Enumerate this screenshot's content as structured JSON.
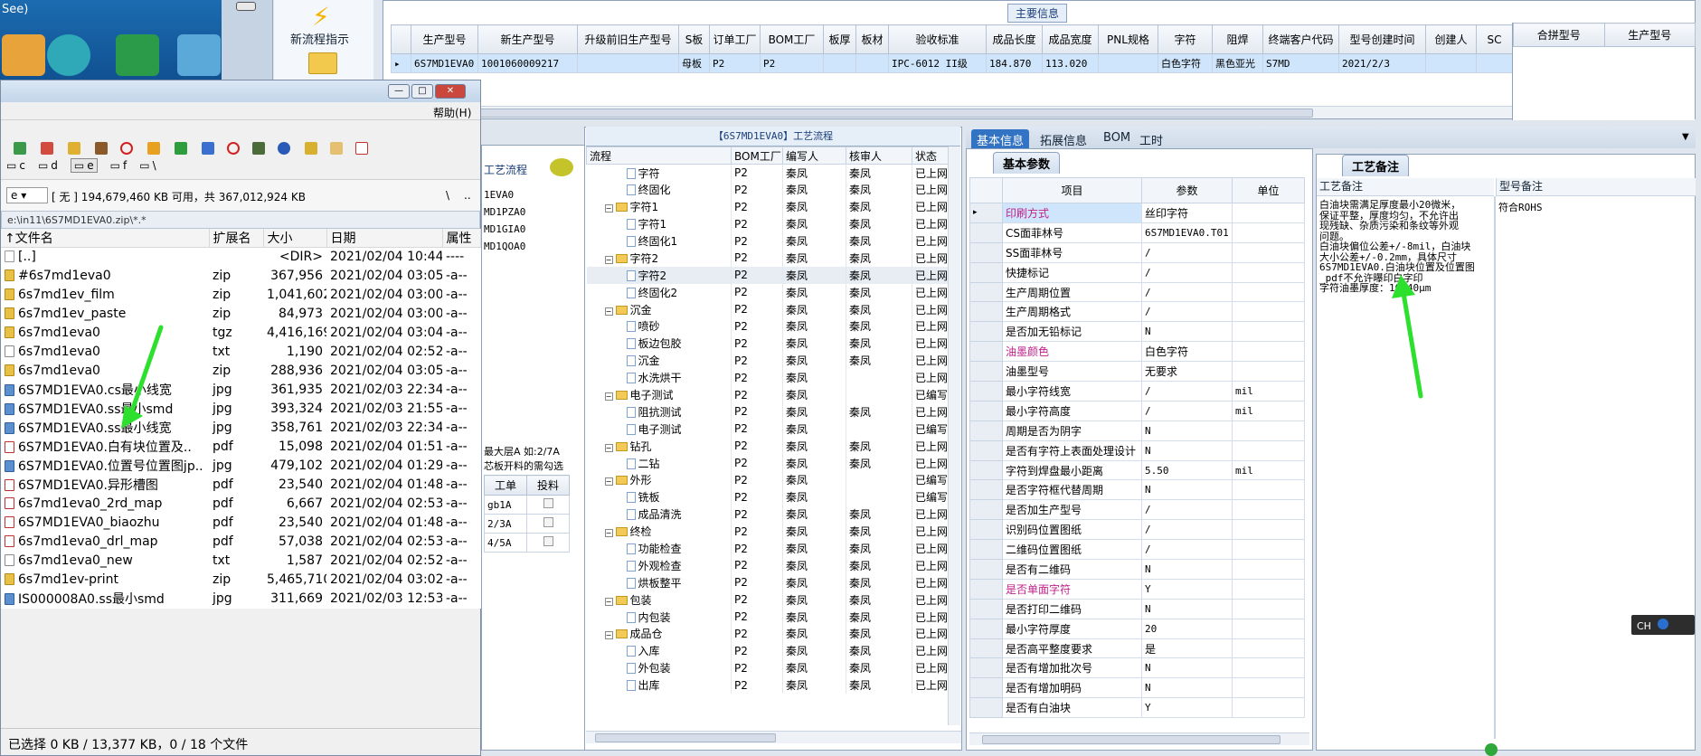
{
  "desktop": {
    "partial_text": "See)"
  },
  "toolbar": {
    "new_flow_label": "新流程指示"
  },
  "main_info": {
    "title": "主要信息",
    "columns": [
      "生产型号",
      "新生产型号",
      "升级前旧生产型号",
      "S板",
      "订单工厂",
      "BOM工厂",
      "板厚",
      "板材",
      "验收标准",
      "成品长度",
      "成品宽度",
      "PNL规格",
      "字符",
      "阻焊",
      "终端客户代码",
      "型号创建时间",
      "创建人",
      "SC"
    ],
    "row": [
      "6S7MD1EVA0",
      "1001060009217",
      "",
      "母板",
      "P2",
      "P2",
      "",
      "",
      "IPC-6012 II级",
      "184.870",
      "113.020",
      "",
      "白色字符",
      "黑色亚光",
      "S7MD",
      "2021/2/3",
      "",
      ""
    ],
    "right_columns": [
      "合拼型号",
      "生产型号"
    ]
  },
  "file_manager": {
    "menu_help": "帮助(H)",
    "drives": [
      "c",
      "d",
      "e",
      "f",
      "\\"
    ],
    "drive_select": "e",
    "space_info": "[ 无 ]  194,679,460 KB 可用，共 367,012,924 KB",
    "path": "e:\\in11\\6S7MD1EVA0.zip\\*.*",
    "path_buttons": [
      "\\",
      ".."
    ],
    "headers": [
      "↑文件名",
      "扩展名",
      "大小",
      "日期",
      "属性"
    ],
    "files": [
      {
        "icon": "dir",
        "name": "[..]",
        "ext": "",
        "size": "<DIR>",
        "date": "2021/02/04 10:44",
        "attr": "----"
      },
      {
        "icon": "zip",
        "name": "#6s7md1eva0",
        "ext": "zip",
        "size": "367,956",
        "date": "2021/02/04 03:05",
        "attr": "-a--"
      },
      {
        "icon": "zip",
        "name": "6s7md1ev_film",
        "ext": "zip",
        "size": "1,041,602",
        "date": "2021/02/04 03:00",
        "attr": "-a--"
      },
      {
        "icon": "zip",
        "name": "6s7md1ev_paste",
        "ext": "zip",
        "size": "84,973",
        "date": "2021/02/04 03:00",
        "attr": "-a--"
      },
      {
        "icon": "zip",
        "name": "6s7md1eva0",
        "ext": "tgz",
        "size": "4,416,169",
        "date": "2021/02/04 03:04",
        "attr": "-a--"
      },
      {
        "icon": "txt",
        "name": "6s7md1eva0",
        "ext": "txt",
        "size": "1,190",
        "date": "2021/02/04 02:52",
        "attr": "-a--"
      },
      {
        "icon": "zip",
        "name": "6s7md1eva0",
        "ext": "zip",
        "size": "288,936",
        "date": "2021/02/04 03:05",
        "attr": "-a--"
      },
      {
        "icon": "jpg",
        "name": "6S7MD1EVA0.cs最小线宽",
        "ext": "jpg",
        "size": "361,935",
        "date": "2021/02/03 22:34",
        "attr": "-a--"
      },
      {
        "icon": "jpg",
        "name": "6S7MD1EVA0.ss最小smd",
        "ext": "jpg",
        "size": "393,324",
        "date": "2021/02/03 21:55",
        "attr": "-a--"
      },
      {
        "icon": "jpg",
        "name": "6S7MD1EVA0.ss最小线宽",
        "ext": "jpg",
        "size": "358,761",
        "date": "2021/02/03 22:34",
        "attr": "-a--"
      },
      {
        "icon": "pdf",
        "name": "6S7MD1EVA0.白有块位置及..",
        "ext": "pdf",
        "size": "15,098",
        "date": "2021/02/04 01:51",
        "attr": "-a--"
      },
      {
        "icon": "jpg",
        "name": "6S7MD1EVA0.位置号位置图jp..",
        "ext": "jpg",
        "size": "479,102",
        "date": "2021/02/04 01:29",
        "attr": "-a--"
      },
      {
        "icon": "pdf",
        "name": "6S7MD1EVA0.异形槽图",
        "ext": "pdf",
        "size": "23,540",
        "date": "2021/02/04 01:48",
        "attr": "-a--"
      },
      {
        "icon": "pdf",
        "name": "6s7md1eva0_2rd_map",
        "ext": "pdf",
        "size": "6,667",
        "date": "2021/02/04 02:53",
        "attr": "-a--"
      },
      {
        "icon": "pdf",
        "name": "6S7MD1EVA0_biaozhu",
        "ext": "pdf",
        "size": "23,540",
        "date": "2021/02/04 01:48",
        "attr": "-a--"
      },
      {
        "icon": "pdf",
        "name": "6s7md1eva0_drl_map",
        "ext": "pdf",
        "size": "57,038",
        "date": "2021/02/04 02:53",
        "attr": "-a--"
      },
      {
        "icon": "txt",
        "name": "6s7md1eva0_new",
        "ext": "txt",
        "size": "1,587",
        "date": "2021/02/04 02:52",
        "attr": "-a--"
      },
      {
        "icon": "zip",
        "name": "6s7md1ev-print",
        "ext": "zip",
        "size": "5,465,710",
        "date": "2021/02/04 03:02",
        "attr": "-a--"
      },
      {
        "icon": "jpg",
        "name": "IS000008A0.ss最小smd",
        "ext": "jpg",
        "size": "311,669",
        "date": "2021/02/03 12:53",
        "attr": "-a--"
      }
    ],
    "status": "已选择 0 KB / 13,377 KB，0 / 18 个文件"
  },
  "mid_panel": {
    "title": "工艺流程",
    "items": [
      "1EVA0",
      "MD1PZA0",
      "MD1GIA0",
      "MD1QOA0"
    ],
    "note_line1": "最大层A 如:2/7A",
    "note_line2": "芯板开料的需勾选",
    "col_order": "工单",
    "col_feed": "投料",
    "rows": [
      "gb1A",
      "2/3A",
      "4/5A"
    ]
  },
  "process_flow": {
    "title": "【6S7MD1EVA0】工艺流程",
    "headers": [
      "流程",
      "BOM工厂",
      "编写人",
      "核审人",
      "状态"
    ],
    "rows": [
      {
        "lvl": 2,
        "name": "字符",
        "bom": "P2",
        "w": "秦凤",
        "r": "秦凤",
        "s": "已上网"
      },
      {
        "lvl": 2,
        "name": "终固化",
        "bom": "P2",
        "w": "秦凤",
        "r": "秦凤",
        "s": "已上网"
      },
      {
        "lvl": 1,
        "name": "字符1",
        "bom": "P2",
        "w": "秦凤",
        "r": "秦凤",
        "s": "已上网"
      },
      {
        "lvl": 2,
        "name": "字符1",
        "bom": "P2",
        "w": "秦凤",
        "r": "秦凤",
        "s": "已上网"
      },
      {
        "lvl": 2,
        "name": "终固化1",
        "bom": "P2",
        "w": "秦凤",
        "r": "秦凤",
        "s": "已上网"
      },
      {
        "lvl": 1,
        "name": "字符2",
        "bom": "P2",
        "w": "秦凤",
        "r": "秦凤",
        "s": "已上网"
      },
      {
        "lvl": 2,
        "name": "字符2",
        "bom": "P2",
        "w": "秦凤",
        "r": "秦凤",
        "s": "已上网"
      },
      {
        "lvl": 2,
        "name": "终固化2",
        "bom": "P2",
        "w": "秦凤",
        "r": "秦凤",
        "s": "已上网"
      },
      {
        "lvl": 1,
        "name": "沉金",
        "bom": "P2",
        "w": "秦凤",
        "r": "秦凤",
        "s": "已上网"
      },
      {
        "lvl": 2,
        "name": "喷砂",
        "bom": "P2",
        "w": "秦凤",
        "r": "秦凤",
        "s": "已上网"
      },
      {
        "lvl": 2,
        "name": "板边包胶",
        "bom": "P2",
        "w": "秦凤",
        "r": "秦凤",
        "s": "已上网"
      },
      {
        "lvl": 2,
        "name": "沉金",
        "bom": "P2",
        "w": "秦凤",
        "r": "秦凤",
        "s": "已上网"
      },
      {
        "lvl": 2,
        "name": "水洗烘干",
        "bom": "P2",
        "w": "秦凤",
        "r": "",
        "s": "已上网"
      },
      {
        "lvl": 1,
        "name": "电子测试",
        "bom": "P2",
        "w": "秦凤",
        "r": "",
        "s": "已编写"
      },
      {
        "lvl": 2,
        "name": "阻抗测试",
        "bom": "P2",
        "w": "秦凤",
        "r": "秦凤",
        "s": "已上网"
      },
      {
        "lvl": 2,
        "name": "电子测试",
        "bom": "P2",
        "w": "秦凤",
        "r": "",
        "s": "已编写"
      },
      {
        "lvl": 1,
        "name": "钻孔",
        "bom": "P2",
        "w": "秦凤",
        "r": "秦凤",
        "s": "已上网"
      },
      {
        "lvl": 2,
        "name": "二钻",
        "bom": "P2",
        "w": "秦凤",
        "r": "秦凤",
        "s": "已上网"
      },
      {
        "lvl": 1,
        "name": "外形",
        "bom": "P2",
        "w": "秦凤",
        "r": "",
        "s": "已编写"
      },
      {
        "lvl": 2,
        "name": "铣板",
        "bom": "P2",
        "w": "秦凤",
        "r": "",
        "s": "已编写"
      },
      {
        "lvl": 2,
        "name": "成品清洗",
        "bom": "P2",
        "w": "秦凤",
        "r": "秦凤",
        "s": "已上网"
      },
      {
        "lvl": 1,
        "name": "终检",
        "bom": "P2",
        "w": "秦凤",
        "r": "秦凤",
        "s": "已上网"
      },
      {
        "lvl": 2,
        "name": "功能检查",
        "bom": "P2",
        "w": "秦凤",
        "r": "秦凤",
        "s": "已上网"
      },
      {
        "lvl": 2,
        "name": "外观检查",
        "bom": "P2",
        "w": "秦凤",
        "r": "秦凤",
        "s": "已上网"
      },
      {
        "lvl": 2,
        "name": "烘板整平",
        "bom": "P2",
        "w": "秦凤",
        "r": "秦凤",
        "s": "已上网"
      },
      {
        "lvl": 1,
        "name": "包装",
        "bom": "P2",
        "w": "秦凤",
        "r": "秦凤",
        "s": "已上网"
      },
      {
        "lvl": 2,
        "name": "内包装",
        "bom": "P2",
        "w": "秦凤",
        "r": "秦凤",
        "s": "已上网"
      },
      {
        "lvl": 1,
        "name": "成品仓",
        "bom": "P2",
        "w": "秦凤",
        "r": "秦凤",
        "s": "已上网"
      },
      {
        "lvl": 2,
        "name": "入库",
        "bom": "P2",
        "w": "秦凤",
        "r": "秦凤",
        "s": "已上网"
      },
      {
        "lvl": 2,
        "name": "外包装",
        "bom": "P2",
        "w": "秦凤",
        "r": "秦凤",
        "s": "已上网"
      },
      {
        "lvl": 2,
        "name": "出库",
        "bom": "P2",
        "w": "秦凤",
        "r": "秦凤",
        "s": "已上网"
      }
    ]
  },
  "tabs": [
    "基本信息",
    "拓展信息",
    "BOM",
    "工时"
  ],
  "basic_params": {
    "subtab": "基本参数",
    "headers": [
      "项目",
      "参数",
      "单位"
    ],
    "rows": [
      {
        "item": "印刷方式",
        "val": "丝印字符",
        "unit": "",
        "pink": true
      },
      {
        "item": "CS面菲林号",
        "val": "6S7MD1EVA0.T01",
        "unit": ""
      },
      {
        "item": "SS面菲林号",
        "val": "/",
        "unit": ""
      },
      {
        "item": "快捷标记",
        "val": "/",
        "unit": ""
      },
      {
        "item": "生产周期位置",
        "val": "/",
        "unit": ""
      },
      {
        "item": "生产周期格式",
        "val": "/",
        "unit": ""
      },
      {
        "item": "是否加无铅标记",
        "val": "N",
        "unit": ""
      },
      {
        "item": "油墨颜色",
        "val": "白色字符",
        "unit": "",
        "pink": true
      },
      {
        "item": "油墨型号",
        "val": "无要求",
        "unit": ""
      },
      {
        "item": "最小字符线宽",
        "val": "/",
        "unit": "mil"
      },
      {
        "item": "最小字符高度",
        "val": "/",
        "unit": "mil"
      },
      {
        "item": "周期是否为阴字",
        "val": "N",
        "unit": ""
      },
      {
        "item": "是否有字符上表面处理设计",
        "val": "N",
        "unit": ""
      },
      {
        "item": "字符到焊盘最小距离",
        "val": "5.50",
        "unit": "mil"
      },
      {
        "item": "是否字符框代替周期",
        "val": "N",
        "unit": ""
      },
      {
        "item": "是否加生产型号",
        "val": "/",
        "unit": ""
      },
      {
        "item": "识别码位置图纸",
        "val": "/",
        "unit": ""
      },
      {
        "item": "二维码位置图纸",
        "val": "/",
        "unit": ""
      },
      {
        "item": "是否有二维码",
        "val": "N",
        "unit": ""
      },
      {
        "item": "是否单面字符",
        "val": "Y",
        "unit": "",
        "pink": true
      },
      {
        "item": "是否打印二维码",
        "val": "N",
        "unit": ""
      },
      {
        "item": "最小字符厚度",
        "val": "20",
        "unit": ""
      },
      {
        "item": "是否高平整度要求",
        "val": "是",
        "unit": ""
      },
      {
        "item": "是否有增加批次号",
        "val": "N",
        "unit": ""
      },
      {
        "item": "是否有增加明码",
        "val": "N",
        "unit": ""
      },
      {
        "item": "是否有白油块",
        "val": "Y",
        "unit": ""
      }
    ]
  },
  "remarks": {
    "tab": "工艺备注",
    "col1": "工艺备注",
    "col2": "型号备注",
    "text_lines": [
      "白油块需满足厚度最小20微米，",
      "保证平整，厚度均匀，不允许出",
      "现残缺、杂质污染和条纹等外观",
      "问题。",
      "白油块偏位公差+/-8mil，白油块",
      "大小公差+/-0.2mm，具体尺寸",
      "6S7MD1EVA0.白油块位置及位置图",
      "_pdf不允许曝印白字印",
      "字符油墨厚度：10~40μm"
    ],
    "model_remark": "符合ROHS"
  },
  "tray": {
    "ime": "CH"
  },
  "colors": {
    "accent": "#3373c4",
    "pink": "#c2208a",
    "arrow": "#2ee02e"
  }
}
